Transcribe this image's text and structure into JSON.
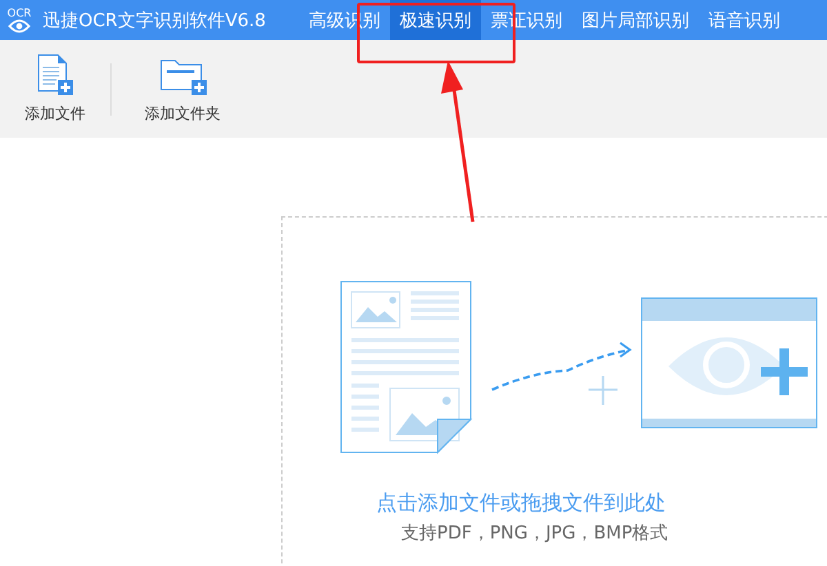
{
  "window": {
    "logo": "OCR",
    "title": "迅捷OCR文字识别软件V6.8"
  },
  "tabs": [
    {
      "label": "高级识别",
      "selected": false
    },
    {
      "label": "极速识别",
      "selected": true
    },
    {
      "label": "票证识别",
      "selected": false
    },
    {
      "label": "图片局部识别",
      "selected": false
    },
    {
      "label": "语音识别",
      "selected": false
    }
  ],
  "toolbar": [
    {
      "kind": "file",
      "label": "添加文件"
    },
    {
      "kind": "folder",
      "label": "添加文件夹"
    }
  ],
  "drop_zone": {
    "prompt": "点击添加文件或拖拽文件到此处",
    "formats": "支持PDF，PNG，JPG，BMP格式"
  }
}
